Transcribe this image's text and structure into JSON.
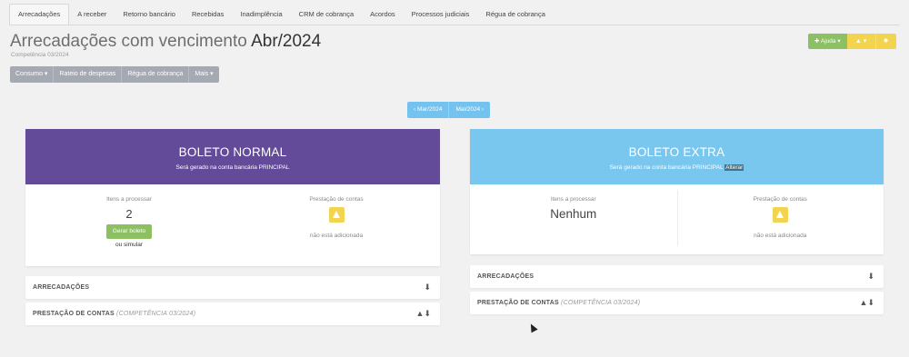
{
  "tabs": [
    {
      "label": "Arrecadações",
      "active": true
    },
    {
      "label": "A receber"
    },
    {
      "label": "Retorno bancário"
    },
    {
      "label": "Recebidas"
    },
    {
      "label": "Inadimplência"
    },
    {
      "label": "CRM de cobrança"
    },
    {
      "label": "Acordos"
    },
    {
      "label": "Processos judiciais"
    },
    {
      "label": "Régua de cobrança"
    }
  ],
  "header": {
    "title_prefix": "Arrecadações com vencimento",
    "title_month": "Abr/2024",
    "subtitle": "Competência 03/2024"
  },
  "subnav": {
    "consumo": "Consumo ▾",
    "rateio": "Rateio de despesas",
    "regua": "Régua de cobrança",
    "mais": "Mais ▾"
  },
  "toolbar": {
    "help": "✚ Ajuda ▾",
    "icon1": "▲ ▾",
    "icon2": "✹"
  },
  "month_nav": {
    "prev": "‹ Mar/2024",
    "next": "Mai/2024 ›"
  },
  "colors": {
    "normal_header": "#644b9a",
    "extra_header": "#79c7ef",
    "green": "#8cc063",
    "yellow": "#f3d44e",
    "blue": "#74c3ee"
  },
  "cards": {
    "normal": {
      "title": "BOLETO NORMAL",
      "sub": "Será gerado na conta bancária PRINCIPAL",
      "items_label": "Itens a processar",
      "items_value": "2",
      "generate_button": "Gerar boleto",
      "or_simulate": "ou simular",
      "accounts_label": "Prestação de contas",
      "accounts_note": "não está adicionada"
    },
    "extra": {
      "title": "BOLETO EXTRA",
      "sub": "Será gerado na conta bancária PRINCIPAL",
      "change": "Alterar",
      "items_label": "Itens a processar",
      "items_value": "Nenhum",
      "accounts_label": "Prestação de contas",
      "accounts_note": "não está adicionada"
    }
  },
  "panels": {
    "left": [
      {
        "label": "ARRECADAÇÕES",
        "extra": "",
        "icon": "⬇"
      },
      {
        "label": "PRESTAÇÃO DE CONTAS",
        "extra": "(COMPETÊNCIA 03/2024)",
        "icon": "▲⬇"
      }
    ],
    "right": [
      {
        "label": "ARRECADAÇÕES",
        "extra": "",
        "icon": "⬇"
      },
      {
        "label": "PRESTAÇÃO DE CONTAS",
        "extra": "(COMPETÊNCIA 03/2024)",
        "icon": "▲⬇"
      }
    ]
  }
}
